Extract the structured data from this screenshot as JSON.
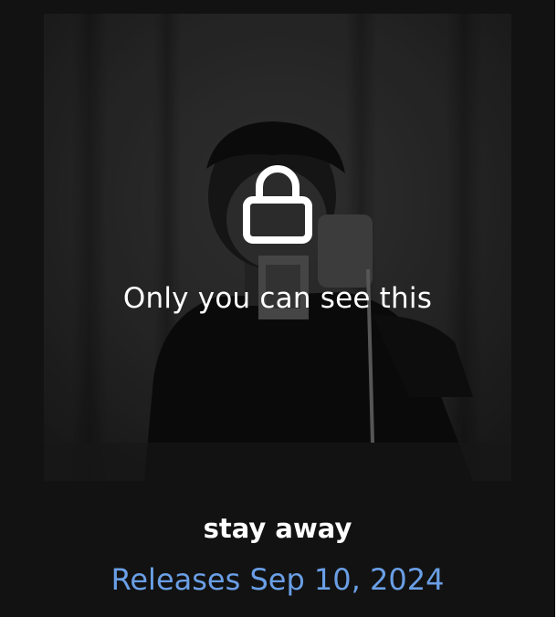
{
  "artwork": {
    "overlay_text": "Only you can see this",
    "icon": "lock-icon"
  },
  "track": {
    "title": "stay away",
    "release_label": "Releases Sep 10, 2024"
  },
  "colors": {
    "background": "#121212",
    "release_text": "#6a9fe6",
    "title_text": "#ffffff"
  }
}
